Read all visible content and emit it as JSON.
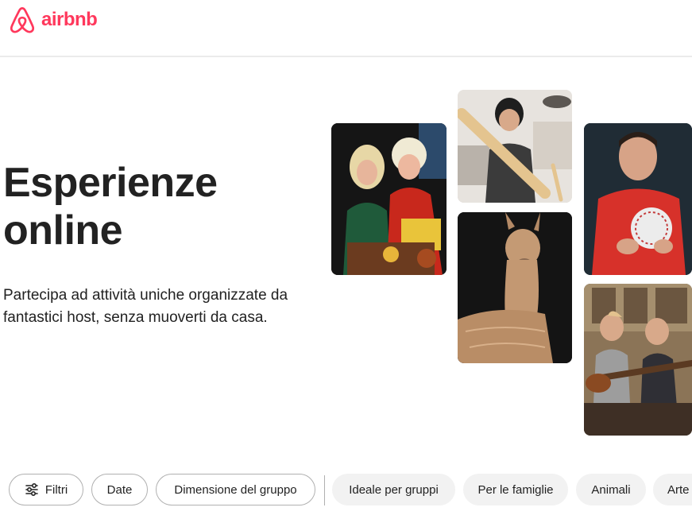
{
  "brand": {
    "name": "airbnb",
    "color": "#ff385c",
    "icon": "airbnb-logo-icon"
  },
  "hero": {
    "title_line1": "Esperienze",
    "title_line2": "online",
    "subtitle_line1": "Partecipa ad attività uniche organizzate da",
    "subtitle_line2": "fantastici host, senza muoverti da casa."
  },
  "filters": {
    "filters_label": "Filtri",
    "filters_icon": "sliders-icon",
    "date_label": "Date",
    "group_size_label": "Dimensione del gruppo",
    "categories": [
      "Ideale per gruppi",
      "Per le famiglie",
      "Animali",
      "Arte"
    ]
  }
}
